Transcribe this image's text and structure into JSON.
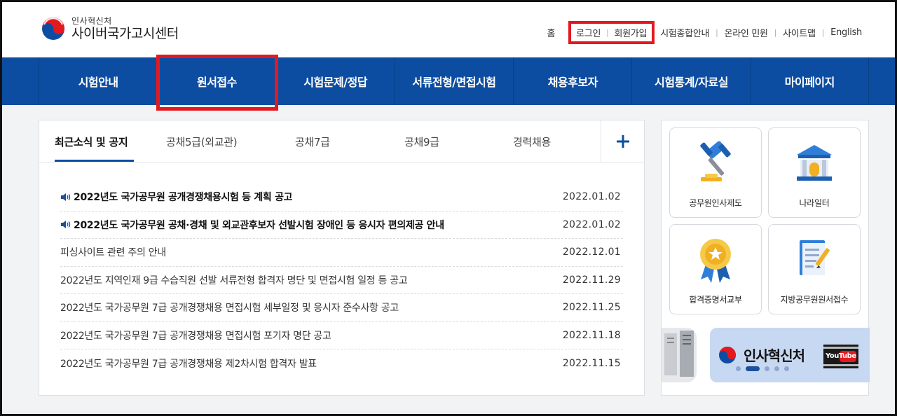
{
  "header": {
    "logo_sub": "인사혁신처",
    "logo_main": "사이버국가고시센터",
    "util_links": {
      "home": "홈",
      "login": "로그인",
      "signup": "회원가입",
      "exam_info": "시험종합안내",
      "online_service": "온라인 민원",
      "sitemap": "사이트맵",
      "english": "English"
    }
  },
  "nav": {
    "items": [
      "시험안내",
      "원서접수",
      "시험문제/정답",
      "서류전형/면접시험",
      "채용후보자",
      "시험통계/자료실",
      "마이페이지"
    ],
    "highlighted": "원서접수"
  },
  "notices": {
    "tabs": [
      "최근소식 및 공지",
      "공채5급(외교관)",
      "공채7급",
      "공채9급",
      "경력채용"
    ],
    "active_tab": "최근소식 및 공지",
    "more_label": "+",
    "items": [
      {
        "title": "2022년도 국가공무원 공개경쟁채용시험 등 계획 공고",
        "date": "2022.01.02",
        "important": true
      },
      {
        "title": "2022년도 국가공무원 공채·경채 및 외교관후보자 선발시험 장애인 등 응시자 편의제공 안내",
        "date": "2022.01.02",
        "important": true
      },
      {
        "title": "피싱사이트 관련 주의 안내",
        "date": "2022.12.01",
        "important": false
      },
      {
        "title": "2022년도 지역인재 9급 수습직원 선발 서류전형 합격자 명단 및 면접시험 일정 등 공고",
        "date": "2022.11.29",
        "important": false
      },
      {
        "title": "2022년도 국가공무원 7급 공개경쟁채용 면접시험 세부일정 및 응시자 준수사항 공고",
        "date": "2022.11.25",
        "important": false
      },
      {
        "title": "2022년도 국가공무원 7급 공개경쟁채용 면접시험 포기자 명단 공고",
        "date": "2022.11.18",
        "important": false
      },
      {
        "title": "2022년도 국가공무원 7급 공개경쟁채용 제2차시험 합격자 발표",
        "date": "2022.11.15",
        "important": false
      }
    ]
  },
  "quick_links": [
    "공무원인사제도",
    "나라일터",
    "합격증명서교부",
    "지방공무원원서접수"
  ],
  "banner": {
    "text": "인사혁신처",
    "youtube_label": "YouTube",
    "page_count": 5,
    "active_page": 2
  },
  "colors": {
    "brand_blue": "#0c4da2",
    "highlight_red": "#e4191f",
    "banner_bg": "#c7d8f2"
  }
}
